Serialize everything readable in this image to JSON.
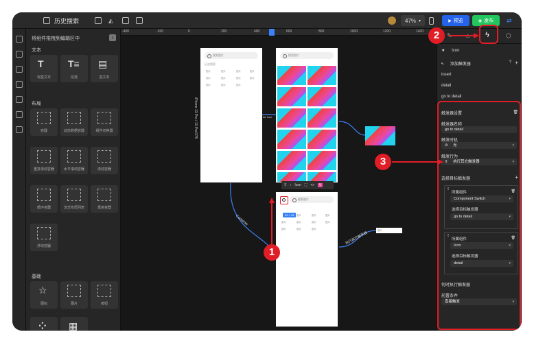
{
  "topbar": {
    "title": "历史搜索",
    "zoom": "47%",
    "preview_label": "预览",
    "publish_label": "发布"
  },
  "panel": {
    "header": "将组件拖拽到编辑区中",
    "collapse_icon": "chevron-left-icon",
    "sections": {
      "text": "文本",
      "layout": "布局",
      "basic": "基础"
    },
    "text_items": [
      "标签文本",
      "段落",
      "富文本"
    ],
    "layout_items": [
      "容器",
      "动态数据容器",
      "组件切换器",
      "重复滚动容器",
      "水平滚动容器",
      "滚动容器",
      "循环容器",
      "流式布局列表",
      "重复容器",
      "浮动容器"
    ],
    "basic_items": [
      "图标",
      "图片",
      "按钮"
    ]
  },
  "canvas": {
    "ruler_ticks": [
      "-400",
      "-200",
      "0",
      "200",
      "400",
      "600",
      "800",
      "1000",
      "1200",
      "1400"
    ],
    "search_placeholder": "搜索图片",
    "history_label": "历史搜索",
    "tag": "图片",
    "phone_side_label": "iPhone 13 Pro / 13 Pro/375",
    "connector_labels": [
      "Container",
      "for Icon",
      "执行其它触发器"
    ],
    "size_badge": "32 × 32",
    "toolbar_label": "Icon"
  },
  "rpanel": {
    "selected": "Icon",
    "add_trigger": "添加触发器",
    "trigger_list": [
      "insert",
      "detail",
      "go to detail"
    ],
    "settings_title": "触发器设置",
    "name_label": "触发器名称",
    "name_value": "go to detail",
    "timing_label": "触发时机",
    "timing_value": "无",
    "action_label": "触发行为",
    "action_value": "执行其它触发器",
    "target_label": "选择目标触发器",
    "card1": {
      "component_label": "所属组件",
      "component_value": "Component Switch",
      "target_label": "选择目标触发器",
      "target_value": "go to detail"
    },
    "card2": {
      "component_label": "所属组件",
      "component_value": "Icon",
      "target_label": "选择目标触发器",
      "target_value": "detail"
    },
    "when_label": "何时执行触发器",
    "precondition_label": "前置条件",
    "precondition_value": "直接触发"
  },
  "annotations": [
    "1",
    "2",
    "3"
  ],
  "colors": {
    "accent_red": "#e11d26",
    "accent_blue": "#3b82f6",
    "preview_blue": "#2563eb",
    "publish_green": "#22c55e"
  }
}
